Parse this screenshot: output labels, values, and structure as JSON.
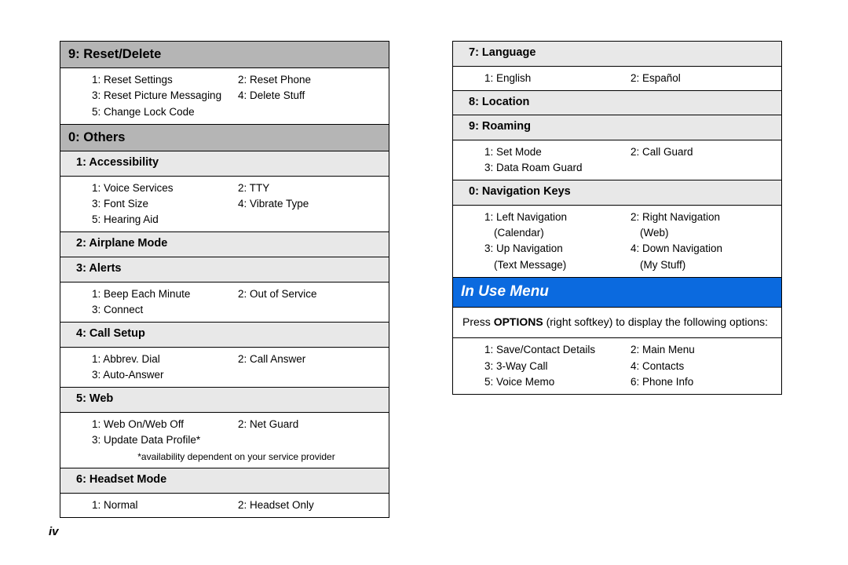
{
  "page_number": "iv",
  "left": {
    "s1": {
      "title": "9: Reset/Delete",
      "items": [
        "1: Reset Settings",
        "2: Reset Phone",
        "3: Reset Picture Messaging",
        "4: Delete Stuff",
        "5: Change Lock Code",
        ""
      ]
    },
    "s2": {
      "title": "0: Others"
    },
    "sub1": {
      "title": "1: Accessibility",
      "items": [
        "1: Voice Services",
        "2: TTY",
        "3: Font Size",
        "4: Vibrate Type",
        "5: Hearing Aid",
        ""
      ]
    },
    "sub2": {
      "title": "2: Airplane Mode"
    },
    "sub3": {
      "title": "3: Alerts",
      "items": [
        "1: Beep Each Minute",
        "2: Out of Service",
        "3: Connect",
        ""
      ]
    },
    "sub4": {
      "title": "4: Call Setup",
      "items": [
        "1: Abbrev. Dial",
        "2: Call Answer",
        "3: Auto-Answer",
        ""
      ]
    },
    "sub5": {
      "title": "5: Web",
      "items": [
        "1: Web On/Web Off",
        "2: Net Guard",
        "3: Update Data Profile*",
        ""
      ],
      "footnote": "*availability dependent on your service provider"
    },
    "sub6": {
      "title": "6: Headset Mode",
      "items": [
        "1: Normal",
        "2: Headset Only"
      ]
    }
  },
  "right": {
    "sub7": {
      "title": "7: Language",
      "items": [
        "1: English",
        "2: Español"
      ]
    },
    "sub8": {
      "title": "8: Location"
    },
    "sub9": {
      "title": "9: Roaming",
      "items": [
        "1: Set Mode",
        "2: Call Guard",
        "3: Data Roam Guard",
        ""
      ]
    },
    "sub0": {
      "title": "0: Navigation Keys",
      "items": [
        "1: Left Navigation",
        "2: Right Navigation",
        "(Calendar)",
        "(Web)",
        "3: Up Navigation",
        "4: Down Navigation",
        "(Text Message)",
        "(My Stuff)"
      ]
    },
    "blue": {
      "title": "In Use Menu"
    },
    "note_pre": "Press ",
    "note_bold": "OPTIONS",
    "note_post": " (right softkey) to display the following options:",
    "inuse_items": [
      "1: Save/Contact Details",
      "2: Main Menu",
      "3: 3-Way Call",
      "4: Contacts",
      "5: Voice Memo",
      "6: Phone Info"
    ]
  }
}
